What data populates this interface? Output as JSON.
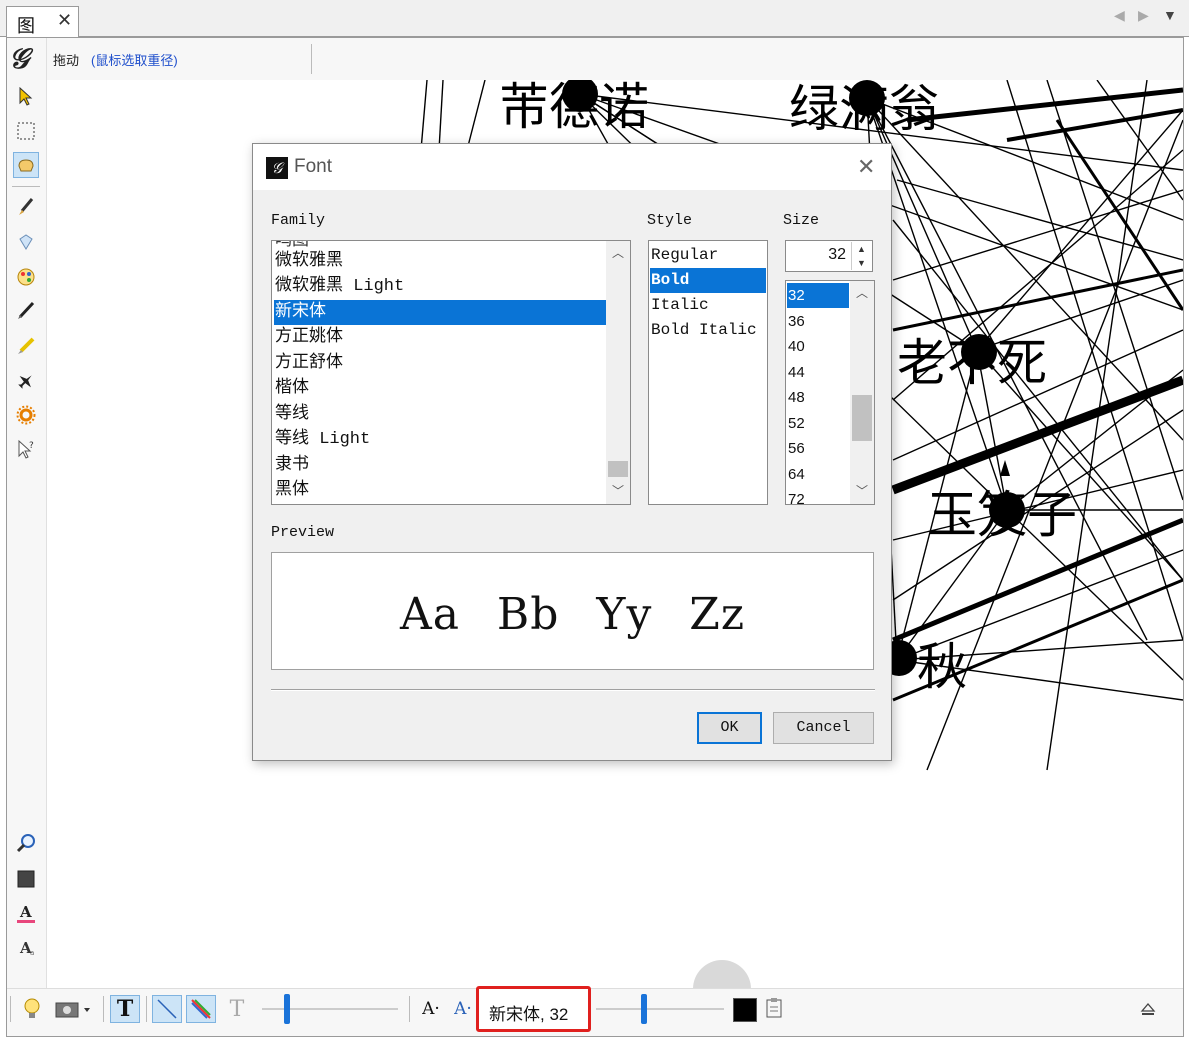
{
  "tab": {
    "label": "图",
    "close": "✕",
    "nav_prev": "◀",
    "nav_next": "▶",
    "nav_menu": "▼"
  },
  "toolbar": {
    "mode_label": "拖动",
    "mode_hint": "(鼠标选取重径)"
  },
  "canvas": {
    "node_labels": [
      "芾德诺",
      "绿满翁",
      "老不死",
      "玉笈子",
      "秋"
    ]
  },
  "dialog": {
    "title": "Font",
    "close": "✕",
    "family_label": "Family",
    "style_label": "Style",
    "size_label": "Size",
    "preview_label": "Preview",
    "preview_text": "Aa Bb Yy Zz",
    "family_items": [
      "微软雅黑",
      "微软雅黑 Light",
      "新宋体",
      "方正姚体",
      "方正舒体",
      "楷体",
      "等线",
      "等线 Light",
      "隶书",
      "黑体"
    ],
    "family_selected": "新宋体",
    "style_items": [
      "Regular",
      "Bold",
      "Italic",
      "Bold Italic"
    ],
    "style_selected": "Bold",
    "size_value": "32",
    "size_items": [
      "32",
      "36",
      "40",
      "44",
      "48",
      "52",
      "56",
      "64",
      "72"
    ],
    "size_selected": "32",
    "ok_label": "OK",
    "cancel_label": "Cancel"
  },
  "bottombar": {
    "font_info": "新宋体, 32",
    "text_icon": "T",
    "font_smaller": "A·",
    "font_larger": "A·",
    "color": "#000000"
  },
  "colors": {
    "accent": "#0a74d6",
    "highlight_box": "#e0201e",
    "hint_blue": "#1f4fcc"
  }
}
